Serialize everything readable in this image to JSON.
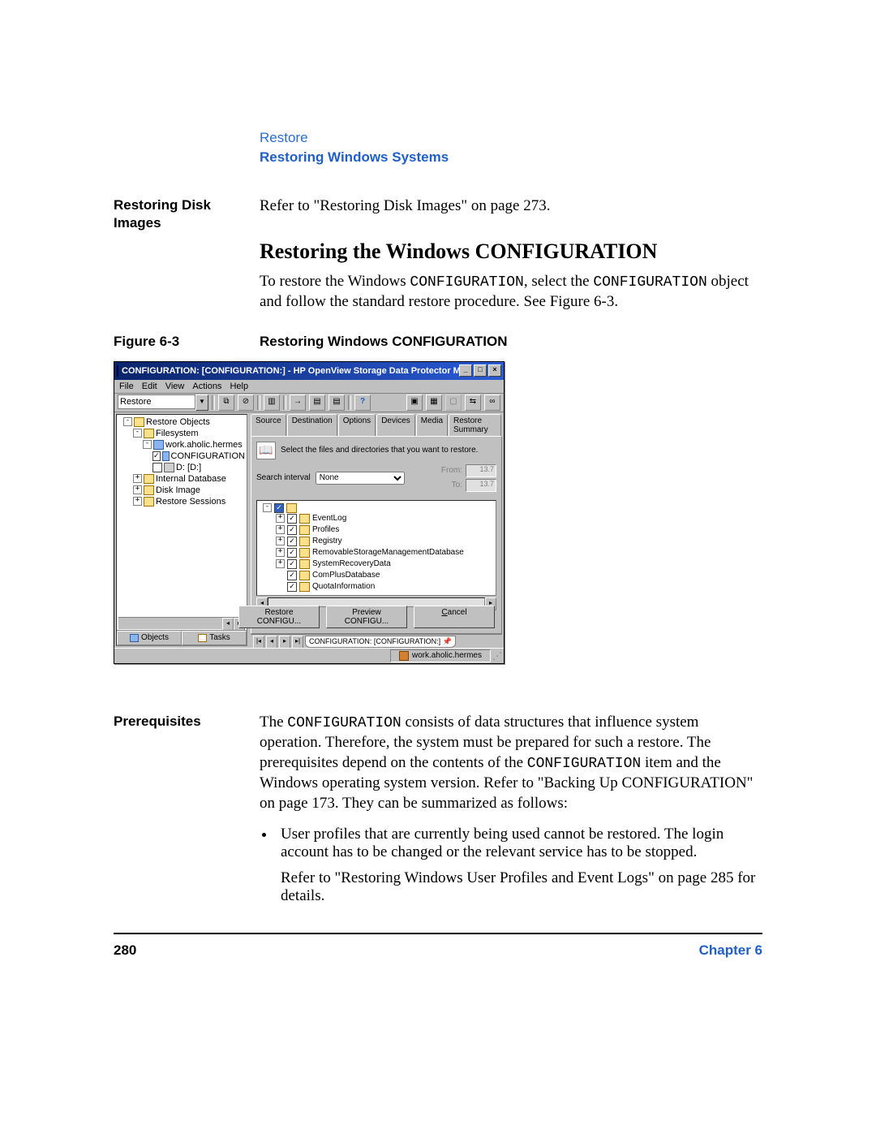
{
  "header": {
    "crumb": "Restore",
    "section": "Restoring Windows Systems"
  },
  "margin1": "Restoring Disk Images",
  "para1": "Refer to \"Restoring Disk Images\" on page 273.",
  "h2": "Restoring the Windows CONFIGURATION",
  "para2a": "To restore the Windows ",
  "para2b": "CONFIGURATION",
  "para2c": ", select the ",
  "para2d": "CONFIGURATION",
  "para2e": " object and follow the standard restore procedure. See Figure 6-3.",
  "fig": {
    "label": "Figure 6-3",
    "caption": "Restoring Windows CONFIGURATION"
  },
  "shot": {
    "title": "CONFIGURATION: [CONFIGURATION:] - HP OpenView Storage Data Protector Manager",
    "menus": [
      "File",
      "Edit",
      "View",
      "Actions",
      "Help"
    ],
    "context_combo": "Restore",
    "left_tree": {
      "root": "Restore Objects",
      "filesystem": "Filesystem",
      "host": "work.aholic.hermes",
      "config": "CONFIGURATION",
      "d_drive": "D: [D:]",
      "internal_db": "Internal Database",
      "disk_image": "Disk Image",
      "restore_sessions": "Restore Sessions"
    },
    "left_tabs": {
      "objects": "Objects",
      "tasks": "Tasks"
    },
    "right": {
      "tabs": [
        "Source",
        "Destination",
        "Options",
        "Devices",
        "Media",
        "Restore Summary"
      ],
      "info": "Select the files and directories that you want to restore.",
      "search_label": "Search interval",
      "search_value": "None",
      "from_label": "From:",
      "to_label": "To:",
      "from_val": "13.7",
      "to_val": "13.7",
      "items": [
        "EventLog",
        "Profiles",
        "Registry",
        "RemovableStorageManagementDatabase",
        "SystemRecoveryData",
        "ComPlusDatabase",
        "QuotaInformation"
      ],
      "btn_restore": "Restore CONFIGU...",
      "btn_preview": "Preview CONFIGU...",
      "btn_cancel": "Cancel",
      "doc_tab": "CONFIGURATION: [CONFIGURATION:]"
    },
    "status_host": "work.aholic.hermes"
  },
  "margin2": "Prerequisites",
  "para3a": "The ",
  "para3b": "CONFIGURATION",
  "para3c": " consists of data structures that influence system operation. Therefore, the system must be prepared for such a restore. The prerequisites depend on the contents of the ",
  "para3d": "CONFIGURATION",
  "para3e": " item and the Windows operating system version. Refer to \"Backing Up CONFIGURATION\" on page 173. They can be summarized as follows:",
  "bullet1": "User profiles that are currently being used cannot be restored. The login account has to be changed or the relevant service has to be stopped.",
  "bullet_follow": "Refer to \"Restoring Windows User Profiles and Event Logs\" on page 285 for details.",
  "footer": {
    "page": "280",
    "chapter": "Chapter 6"
  }
}
